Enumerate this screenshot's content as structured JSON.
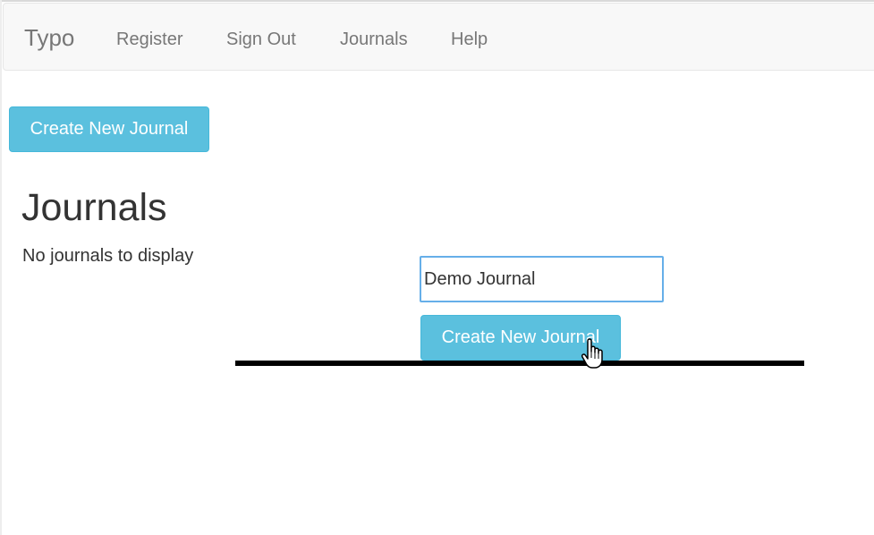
{
  "navbar": {
    "brand": "Typo",
    "links": [
      {
        "label": "Register"
      },
      {
        "label": "Sign Out"
      },
      {
        "label": "Journals"
      },
      {
        "label": "Help"
      }
    ]
  },
  "toolbar": {
    "create_label": "Create New Journal"
  },
  "main": {
    "heading": "Journals",
    "empty_message": "No journals to display"
  },
  "form": {
    "journal_name_value": "Demo Journal",
    "submit_label": "Create New Journal"
  },
  "icons": {
    "cursor": "hand-pointer-icon"
  },
  "colors": {
    "button_bg": "#5bc0de",
    "button_border": "#46b8da",
    "navbar_bg": "#f8f8f8",
    "input_focus_border": "#66afe9",
    "divider": "#000000"
  }
}
